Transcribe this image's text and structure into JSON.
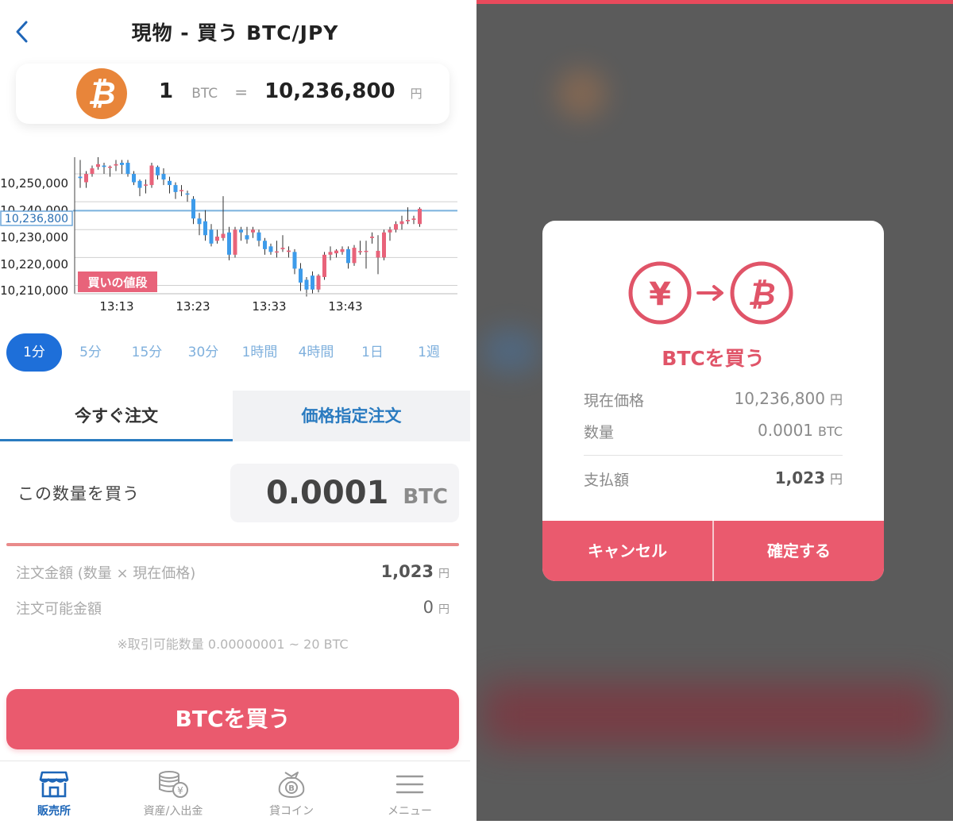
{
  "header": {
    "title": "現物 - 買う BTC/JPY"
  },
  "rate": {
    "coin_symbol": "₿",
    "amount": "1",
    "unit": "BTC",
    "equals": "=",
    "price": "10,236,800",
    "currency": "円"
  },
  "chart": {
    "y_ticks": [
      "10,250,000",
      "10,240,000",
      "10,230,000",
      "10,220,000",
      "10,210,000"
    ],
    "x_ticks": [
      "13:13",
      "13:23",
      "13:33",
      "13:43"
    ],
    "current_price_label": "10,236,800",
    "buy_price_tag": "買いの値段",
    "colors": {
      "up": "#e8637a",
      "down": "#3d9bea",
      "current_line": "#7ab1de"
    }
  },
  "chart_data": {
    "type": "candlestick",
    "ylim": [
      10207000,
      10256000
    ],
    "current_price": 10236800,
    "x_labels": [
      "13:13",
      "13:23",
      "13:33",
      "13:43"
    ],
    "candles": [
      {
        "o": 10249000,
        "c": 10248500,
        "h": 10255000,
        "l": 10245000
      },
      {
        "o": 10247000,
        "c": 10250000,
        "h": 10251000,
        "l": 10245000
      },
      {
        "o": 10250000,
        "c": 10252000,
        "h": 10253000,
        "l": 10249000
      },
      {
        "o": 10252500,
        "c": 10253500,
        "h": 10256000,
        "l": 10251500
      },
      {
        "o": 10253000,
        "c": 10252500,
        "h": 10254000,
        "l": 10250000
      },
      {
        "o": 10252500,
        "c": 10252600,
        "h": 10253000,
        "l": 10249000
      },
      {
        "o": 10253000,
        "c": 10253500,
        "h": 10255000,
        "l": 10251000
      },
      {
        "o": 10254000,
        "c": 10253200,
        "h": 10255000,
        "l": 10250000
      },
      {
        "o": 10254000,
        "c": 10250000,
        "h": 10255000,
        "l": 10249000
      },
      {
        "o": 10250000,
        "c": 10247000,
        "h": 10251000,
        "l": 10246000
      },
      {
        "o": 10247500,
        "c": 10245000,
        "h": 10248000,
        "l": 10242000
      },
      {
        "o": 10246000,
        "c": 10246200,
        "h": 10248000,
        "l": 10243000
      },
      {
        "o": 10246000,
        "c": 10253000,
        "h": 10254000,
        "l": 10245000
      },
      {
        "o": 10252500,
        "c": 10249500,
        "h": 10253000,
        "l": 10248000
      },
      {
        "o": 10250000,
        "c": 10248000,
        "h": 10252000,
        "l": 10246000
      },
      {
        "o": 10247500,
        "c": 10246000,
        "h": 10249000,
        "l": 10243000
      },
      {
        "o": 10246000,
        "c": 10243500,
        "h": 10247000,
        "l": 10241000
      },
      {
        "o": 10244000,
        "c": 10244200,
        "h": 10246000,
        "l": 10242000
      },
      {
        "o": 10243000,
        "c": 10242800,
        "h": 10244000,
        "l": 10240000
      },
      {
        "o": 10241000,
        "c": 10234000,
        "h": 10242000,
        "l": 10232000
      },
      {
        "o": 10234000,
        "c": 10232000,
        "h": 10236000,
        "l": 10228000
      },
      {
        "o": 10233000,
        "c": 10228000,
        "h": 10237000,
        "l": 10226000
      },
      {
        "o": 10230000,
        "c": 10225000,
        "h": 10232000,
        "l": 10224000
      },
      {
        "o": 10226000,
        "c": 10227500,
        "h": 10230000,
        "l": 10225000
      },
      {
        "o": 10227000,
        "c": 10228500,
        "h": 10242000,
        "l": 10226000
      },
      {
        "o": 10229000,
        "c": 10221000,
        "h": 10231000,
        "l": 10219000
      },
      {
        "o": 10221000,
        "c": 10230000,
        "h": 10231000,
        "l": 10220000
      },
      {
        "o": 10230000,
        "c": 10229000,
        "h": 10231000,
        "l": 10226000
      },
      {
        "o": 10228000,
        "c": 10226500,
        "h": 10231000,
        "l": 10225000
      },
      {
        "o": 10229000,
        "c": 10230000,
        "h": 10231000,
        "l": 10227000
      },
      {
        "o": 10229000,
        "c": 10226000,
        "h": 10230000,
        "l": 10224000
      },
      {
        "o": 10226000,
        "c": 10223000,
        "h": 10227000,
        "l": 10221000
      },
      {
        "o": 10224000,
        "c": 10222000,
        "h": 10225000,
        "l": 10221000
      },
      {
        "o": 10222000,
        "c": 10222200,
        "h": 10226000,
        "l": 10220000
      },
      {
        "o": 10223000,
        "c": 10223500,
        "h": 10228000,
        "l": 10222000
      },
      {
        "o": 10222000,
        "c": 10222500,
        "h": 10224000,
        "l": 10220000
      },
      {
        "o": 10222000,
        "c": 10216000,
        "h": 10223000,
        "l": 10214000
      },
      {
        "o": 10216000,
        "c": 10211000,
        "h": 10218000,
        "l": 10208000
      },
      {
        "o": 10212000,
        "c": 10208500,
        "h": 10213000,
        "l": 10206000
      },
      {
        "o": 10213500,
        "c": 10208500,
        "h": 10215000,
        "l": 10207000
      },
      {
        "o": 10208500,
        "c": 10213500,
        "h": 10214000,
        "l": 10207500
      },
      {
        "o": 10213000,
        "c": 10221000,
        "h": 10222000,
        "l": 10212000
      },
      {
        "o": 10221000,
        "c": 10222000,
        "h": 10224000,
        "l": 10219000
      },
      {
        "o": 10221500,
        "c": 10222500,
        "h": 10223000,
        "l": 10220000
      },
      {
        "o": 10222000,
        "c": 10223000,
        "h": 10224000,
        "l": 10221000
      },
      {
        "o": 10223000,
        "c": 10218000,
        "h": 10224000,
        "l": 10216000
      },
      {
        "o": 10218000,
        "c": 10223500,
        "h": 10224500,
        "l": 10217000
      },
      {
        "o": 10222000,
        "c": 10222300,
        "h": 10226000,
        "l": 10221000
      },
      {
        "o": 10222000,
        "c": 10222400,
        "h": 10226000,
        "l": 10216000
      },
      {
        "o": 10227000,
        "c": 10227500,
        "h": 10229000,
        "l": 10225000
      },
      {
        "o": 10220000,
        "c": 10222400,
        "h": 10228000,
        "l": 10214000
      },
      {
        "o": 10220000,
        "c": 10229000,
        "h": 10230000,
        "l": 10219000
      },
      {
        "o": 10229000,
        "c": 10230000,
        "h": 10231000,
        "l": 10226000
      },
      {
        "o": 10230000,
        "c": 10232000,
        "h": 10233000,
        "l": 10229000
      },
      {
        "o": 10232000,
        "c": 10233000,
        "h": 10235000,
        "l": 10230000
      },
      {
        "o": 10233000,
        "c": 10233500,
        "h": 10238000,
        "l": 10232000
      },
      {
        "o": 10233500,
        "c": 10234000,
        "h": 10235000,
        "l": 10232000
      },
      {
        "o": 10232000,
        "c": 10237500,
        "h": 10238000,
        "l": 10231000
      }
    ]
  },
  "timeframes": [
    "1分",
    "5分",
    "15分",
    "30分",
    "1時間",
    "4時間",
    "1日",
    "1週"
  ],
  "active_timeframe": "1分",
  "tabs": {
    "market": "今すぐ注文",
    "limit": "価格指定注文"
  },
  "order": {
    "qty_label": "この数量を買う",
    "qty_value": "0.0001",
    "qty_unit": "BTC",
    "amount_label": "注文金額 (数量 × 現在価格)",
    "amount_value": "1,023",
    "available_label": "注文可能金額",
    "available_value": "0",
    "yen": "円",
    "note": "※取引可能数量 0.00000001 ~ 20 BTC",
    "buy_button": "BTCを買う"
  },
  "nav": [
    {
      "label": "販売所",
      "icon": "shop-icon",
      "active": true
    },
    {
      "label": "資産/入出金",
      "icon": "coins-icon",
      "active": false
    },
    {
      "label": "貸コイン",
      "icon": "coin-bag-icon",
      "active": false
    },
    {
      "label": "メニュー",
      "icon": "menu-icon",
      "active": false
    }
  ],
  "modal": {
    "from_symbol": "¥",
    "to_symbol": "₿",
    "title": "BTCを買う",
    "price_label": "現在価格",
    "price_value": "10,236,800",
    "price_unit": "円",
    "qty_label": "数量",
    "qty_value": "0.0001",
    "qty_unit": "BTC",
    "total_label": "支払額",
    "total_value": "1,023",
    "total_unit": "円",
    "cancel": "キャンセル",
    "confirm": "確定する",
    "accent": "#e05468"
  }
}
